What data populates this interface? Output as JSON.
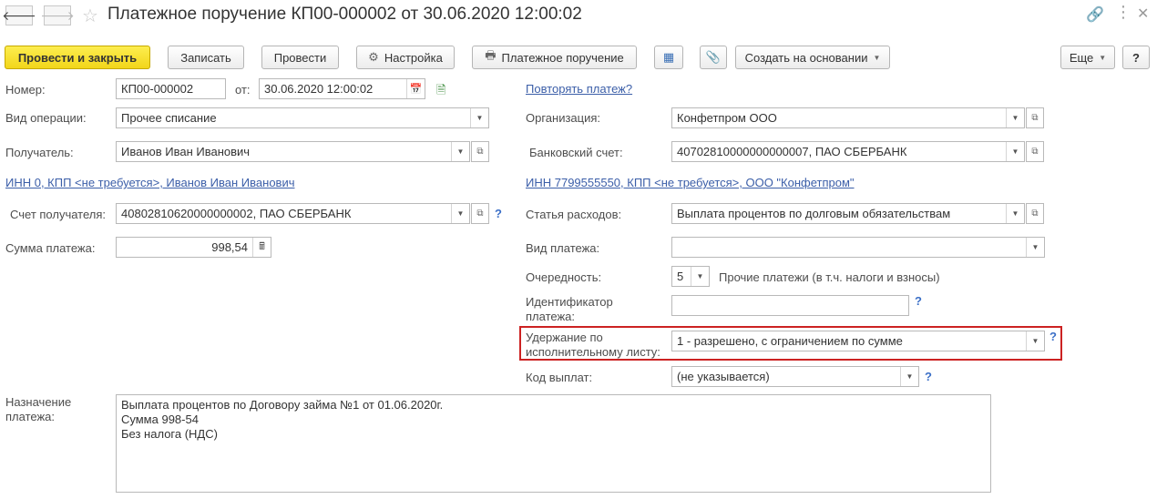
{
  "header": {
    "title": "Платежное поручение КП00-000002 от 30.06.2020 12:00:02",
    "back_icon": "arrow-left-icon",
    "forward_icon": "arrow-right-icon",
    "favorite_icon": "star-icon"
  },
  "toolbar": {
    "post_close": "Провести и закрыть",
    "save": "Записать",
    "post": "Провести",
    "settings": "Настройка",
    "print_payment_order": "Платежное поручение",
    "create_based_on": "Создать на основании",
    "more": "Еще",
    "help": "?"
  },
  "form": {
    "number_label": "Номер:",
    "number_value": "КП00-000002",
    "date_label": "от:",
    "date_value": "30.06.2020 12:00:02",
    "repeat_payment_link": "Повторять платеж?",
    "operation_label": "Вид операции:",
    "operation_value": "Прочее списание",
    "organization_label": "Организация:",
    "organization_value": "Конфетпром ООО",
    "recipient_label": "Получатель:",
    "recipient_value": "Иванов Иван Иванович",
    "bank_account_label": "Банковский счет:",
    "bank_account_value": "40702810000000000007, ПАО СБЕРБАНК",
    "recipient_inn_link": "ИНН 0, КПП <не требуется>, Иванов Иван Иванович",
    "org_inn_link": "ИНН 7799555550, КПП <не требуется>, ООО \"Конфетпром\"",
    "recipient_account_label": "Счет получателя:",
    "recipient_account_value": "40802810620000000002, ПАО СБЕРБАНК",
    "expense_item_label": "Статья расходов:",
    "expense_item_value": "Выплата процентов по долговым обязательствам",
    "amount_label": "Сумма платежа:",
    "amount_value": "998,54",
    "payment_type_label": "Вид платежа:",
    "payment_type_value": "",
    "priority_label": "Очередность:",
    "priority_value": "5",
    "priority_description": "Прочие платежи (в т.ч. налоги и взносы)",
    "payment_id_label_1": "Идентификатор",
    "payment_id_label_2": "платежа:",
    "payment_id_value": "",
    "withholding_label_1": "Удержание по",
    "withholding_label_2": "исполнительному листу:",
    "withholding_value": "1 - разрешено, с ограничением по сумме",
    "payout_code_label": "Код выплат:",
    "payout_code_value": "(не указывается)",
    "purpose_label_1": "Назначение",
    "purpose_label_2": "платежа:",
    "purpose_lines": [
      "Выплата процентов по Договору займа №1 от 01.06.2020г.",
      "Сумма 998-54",
      "Без налога (НДС)"
    ],
    "help_mark": "?"
  }
}
